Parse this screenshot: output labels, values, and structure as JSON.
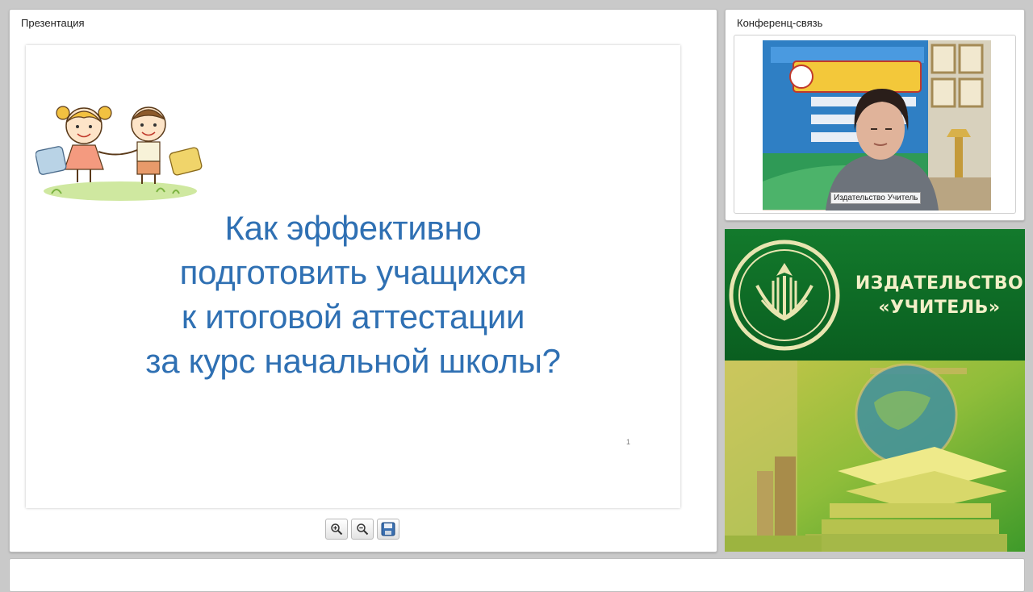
{
  "presentation": {
    "title": "Презентация",
    "slide": {
      "lines": [
        "Как эффективно",
        "подготовить учащихся",
        "к итоговой аттестации",
        "за курс начальной школы?"
      ],
      "page_number": "1"
    },
    "toolbar": {
      "icons": [
        "zoom-in-icon",
        "zoom-out-icon",
        "save-icon"
      ]
    }
  },
  "conference": {
    "title": "Конференц-связь",
    "participant_name": "Издательство Учитель"
  },
  "banner": {
    "line1": "ИЗДАТЕЛЬСТВО",
    "line2": "«УЧИТЕЛЬ»"
  },
  "colors": {
    "slide_title": "#2f70b3",
    "banner_green": "#0d6d25",
    "banner_text": "#f3f0c8"
  }
}
